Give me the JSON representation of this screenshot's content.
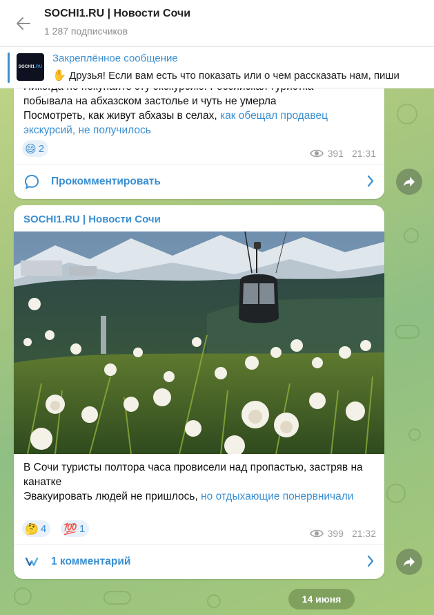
{
  "header": {
    "title": "SOCHI1.RU | Новости Сочи",
    "subscribers": "1 287 подписчиков"
  },
  "pinned": {
    "title": "Закреплённое сообщение",
    "text": "Друзья! Если вам есть что показать или о чем рассказать нам, пиши",
    "emoji": "✋",
    "thumb_text": "SOCHI1",
    "thumb_text_ru": ".RU"
  },
  "posts": [
    {
      "text_line_cut": "Никогда не покупайте эту экскурсию: Российская туристка",
      "text_line2": "побывала на абхазском застолье и чуть не умерла",
      "text_line3": "Посмотреть, как живут абхазы в селах, ",
      "link_text": "как обещал продавец экскурсий, не получилось",
      "reactions": [
        {
          "emoji": "😄",
          "count": "2"
        }
      ],
      "views": "391",
      "time": "21:31",
      "comment_label": "Прокомментировать"
    },
    {
      "channel": "SOCHI1.RU | Новости Сочи",
      "text_line1": "В Сочи туристы полтора часа провисели над пропастью, застряв на канатке",
      "text_line2": "Эвакуировать людей не пришлось, ",
      "link_text": "но отдыхающие понервничали",
      "reactions": [
        {
          "emoji": "🤔",
          "count": "4"
        },
        {
          "emoji": "💯",
          "count": "1"
        }
      ],
      "views": "399",
      "time": "21:32",
      "comment_label": "1 комментарий"
    }
  ],
  "date_separator": "14 июня",
  "colors": {
    "accent": "#3a8fd1",
    "meta": "#a0a0a0"
  }
}
